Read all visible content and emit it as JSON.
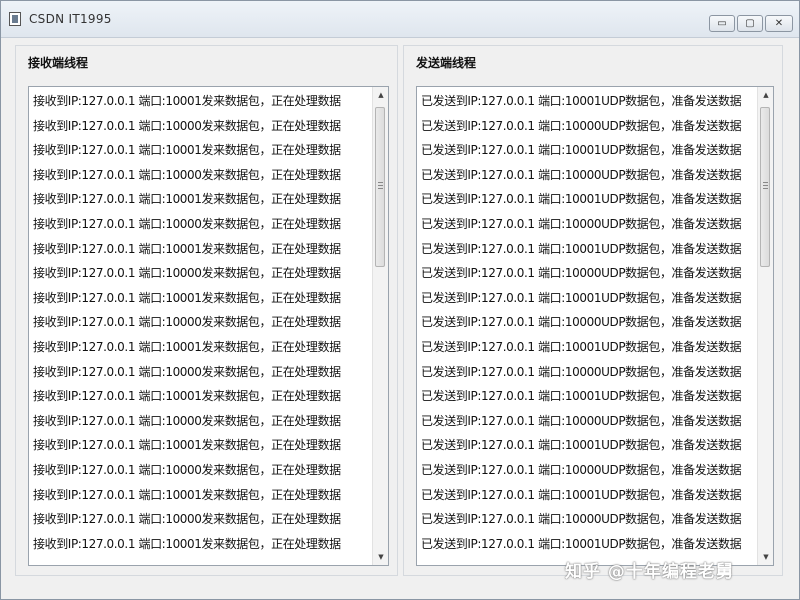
{
  "window": {
    "title": "CSDN IT1995",
    "min_glyph": "▭",
    "max_glyph": "▢",
    "close_glyph": "✕"
  },
  "receive_panel": {
    "title": "接收端线程",
    "rows": [
      "接收到IP:127.0.0.1 端口:10001发来数据包，正在处理数据",
      "接收到IP:127.0.0.1 端口:10000发来数据包，正在处理数据",
      "接收到IP:127.0.0.1 端口:10001发来数据包，正在处理数据",
      "接收到IP:127.0.0.1 端口:10000发来数据包，正在处理数据",
      "接收到IP:127.0.0.1 端口:10001发来数据包，正在处理数据",
      "接收到IP:127.0.0.1 端口:10000发来数据包，正在处理数据",
      "接收到IP:127.0.0.1 端口:10001发来数据包，正在处理数据",
      "接收到IP:127.0.0.1 端口:10000发来数据包，正在处理数据",
      "接收到IP:127.0.0.1 端口:10001发来数据包，正在处理数据",
      "接收到IP:127.0.0.1 端口:10000发来数据包，正在处理数据",
      "接收到IP:127.0.0.1 端口:10001发来数据包，正在处理数据",
      "接收到IP:127.0.0.1 端口:10000发来数据包，正在处理数据",
      "接收到IP:127.0.0.1 端口:10001发来数据包，正在处理数据",
      "接收到IP:127.0.0.1 端口:10000发来数据包，正在处理数据",
      "接收到IP:127.0.0.1 端口:10001发来数据包，正在处理数据",
      "接收到IP:127.0.0.1 端口:10000发来数据包，正在处理数据",
      "接收到IP:127.0.0.1 端口:10001发来数据包，正在处理数据",
      "接收到IP:127.0.0.1 端口:10000发来数据包，正在处理数据",
      "接收到IP:127.0.0.1 端口:10001发来数据包，正在处理数据"
    ]
  },
  "send_panel": {
    "title": "发送端线程",
    "rows": [
      "已发送到IP:127.0.0.1 端口:10001UDP数据包，准备发送数据",
      "已发送到IP:127.0.0.1 端口:10000UDP数据包，准备发送数据",
      "已发送到IP:127.0.0.1 端口:10001UDP数据包，准备发送数据",
      "已发送到IP:127.0.0.1 端口:10000UDP数据包，准备发送数据",
      "已发送到IP:127.0.0.1 端口:10001UDP数据包，准备发送数据",
      "已发送到IP:127.0.0.1 端口:10000UDP数据包，准备发送数据",
      "已发送到IP:127.0.0.1 端口:10001UDP数据包，准备发送数据",
      "已发送到IP:127.0.0.1 端口:10000UDP数据包，准备发送数据",
      "已发送到IP:127.0.0.1 端口:10001UDP数据包，准备发送数据",
      "已发送到IP:127.0.0.1 端口:10000UDP数据包，准备发送数据",
      "已发送到IP:127.0.0.1 端口:10001UDP数据包，准备发送数据",
      "已发送到IP:127.0.0.1 端口:10000UDP数据包，准备发送数据",
      "已发送到IP:127.0.0.1 端口:10001UDP数据包，准备发送数据",
      "已发送到IP:127.0.0.1 端口:10000UDP数据包，准备发送数据",
      "已发送到IP:127.0.0.1 端口:10001UDP数据包，准备发送数据",
      "已发送到IP:127.0.0.1 端口:10000UDP数据包，准备发送数据",
      "已发送到IP:127.0.0.1 端口:10001UDP数据包，准备发送数据",
      "已发送到IP:127.0.0.1 端口:10000UDP数据包，准备发送数据",
      "已发送到IP:127.0.0.1 端口:10001UDP数据包，准备发送数据"
    ]
  },
  "scrollbar": {
    "up_glyph": "▲",
    "down_glyph": "▼"
  },
  "watermark": "知乎 @十年编程老舅"
}
